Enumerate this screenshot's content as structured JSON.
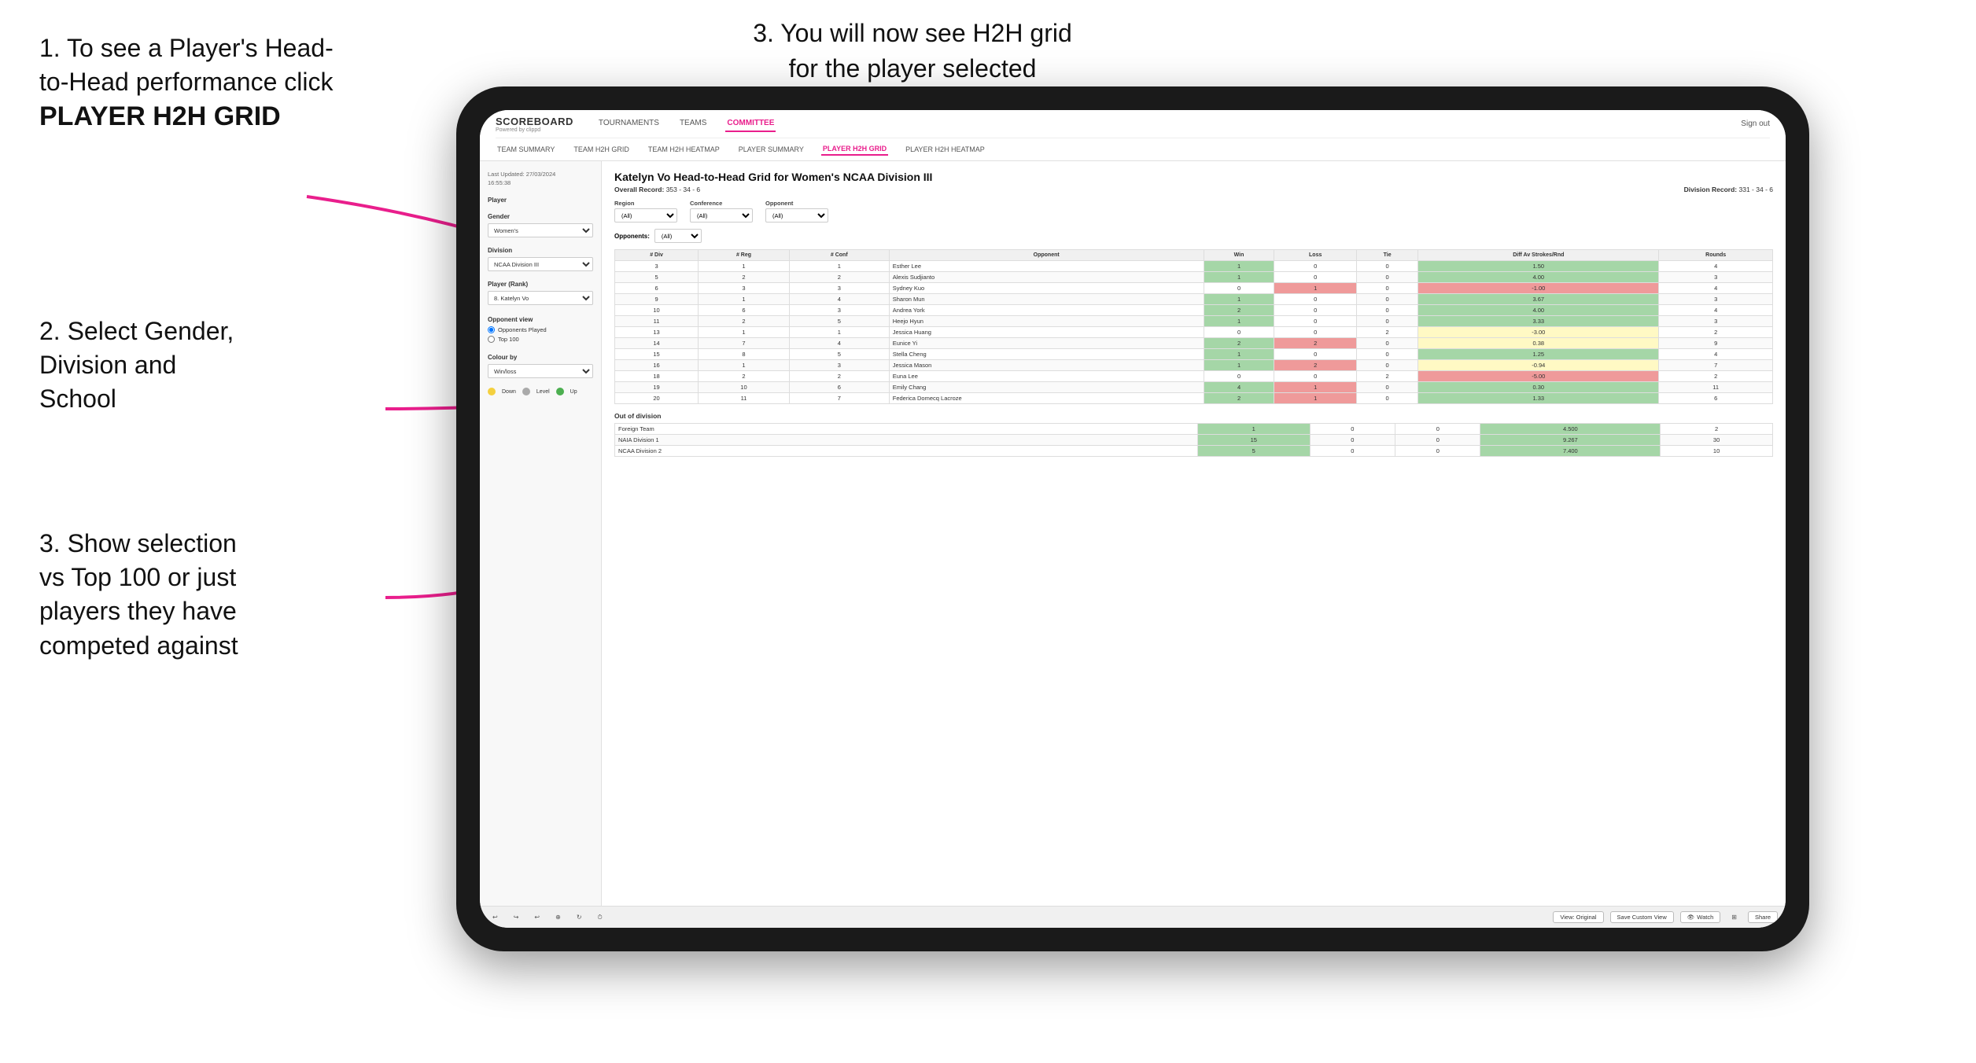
{
  "instructions": {
    "step1_line1": "1. To see a Player's Head-",
    "step1_line2": "to-Head performance click",
    "step1_bold": "PLAYER H2H GRID",
    "step2_line1": "2. Select Gender,",
    "step2_line2": "Division and",
    "step2_line3": "School",
    "step3_left_line1": "3. Show selection",
    "step3_left_line2": "vs Top 100 or just",
    "step3_left_line3": "players they have",
    "step3_left_line4": "competed against",
    "step3_top_line1": "3. You will now see H2H grid",
    "step3_top_line2": "for the player selected"
  },
  "app": {
    "logo": "SCOREBOARD",
    "logo_sub": "Powered by clippd",
    "nav_items": [
      "TOURNAMENTS",
      "TEAMS",
      "COMMITTEE"
    ],
    "nav_right": "Sign out",
    "sub_nav_items": [
      "TEAM SUMMARY",
      "TEAM H2H GRID",
      "TEAM H2H HEATMAP",
      "PLAYER SUMMARY",
      "PLAYER H2H GRID",
      "PLAYER H2H HEATMAP"
    ],
    "active_sub_nav": "PLAYER H2H GRID"
  },
  "sidebar": {
    "timestamp": "Last Updated: 27/03/2024\n16:55:38",
    "player_label": "Player",
    "gender_label": "Gender",
    "gender_value": "Women's",
    "division_label": "Division",
    "division_value": "NCAA Division III",
    "player_rank_label": "Player (Rank)",
    "player_rank_value": "8. Katelyn Vo",
    "opponent_view_label": "Opponent view",
    "radio_opponents": "Opponents Played",
    "radio_top100": "Top 100",
    "colour_by_label": "Colour by",
    "colour_by_value": "Win/loss",
    "legend_down": "Down",
    "legend_level": "Level",
    "legend_up": "Up"
  },
  "grid": {
    "title": "Katelyn Vo Head-to-Head Grid for Women's NCAA Division III",
    "overall_record_label": "Overall Record:",
    "overall_record_value": "353 - 34 - 6",
    "division_record_label": "Division Record:",
    "division_record_value": "331 - 34 - 6",
    "filter_region_label": "Region",
    "filter_conference_label": "Conference",
    "filter_opponent_label": "Opponent",
    "opponents_label": "Opponents:",
    "opponents_value": "(All)",
    "conference_value": "(All)",
    "opponent_filter_value": "(All)",
    "col_headers": [
      "# Div",
      "# Reg",
      "# Conf",
      "Opponent",
      "Win",
      "Loss",
      "Tie",
      "Diff Av Strokes/Rnd",
      "Rounds"
    ],
    "rows": [
      {
        "div": 3,
        "reg": 1,
        "conf": 1,
        "name": "Esther Lee",
        "win": 1,
        "loss": 0,
        "tie": 0,
        "diff": 1.5,
        "rounds": 4,
        "win_color": "green"
      },
      {
        "div": 5,
        "reg": 2,
        "conf": 2,
        "name": "Alexis Sudjianto",
        "win": 1,
        "loss": 0,
        "tie": 0,
        "diff": 4.0,
        "rounds": 3,
        "win_color": "green"
      },
      {
        "div": 6,
        "reg": 3,
        "conf": 3,
        "name": "Sydney Kuo",
        "win": 0,
        "loss": 1,
        "tie": 0,
        "diff": -1.0,
        "rounds": 4,
        "win_color": "red"
      },
      {
        "div": 9,
        "reg": 1,
        "conf": 4,
        "name": "Sharon Mun",
        "win": 1,
        "loss": 0,
        "tie": 0,
        "diff": 3.67,
        "rounds": 3,
        "win_color": "green"
      },
      {
        "div": 10,
        "reg": 6,
        "conf": 3,
        "name": "Andrea York",
        "win": 2,
        "loss": 0,
        "tie": 0,
        "diff": 4.0,
        "rounds": 4,
        "win_color": "green"
      },
      {
        "div": 11,
        "reg": 2,
        "conf": 5,
        "name": "Heejo Hyun",
        "win": 1,
        "loss": 0,
        "tie": 0,
        "diff": 3.33,
        "rounds": 3,
        "win_color": "green"
      },
      {
        "div": 13,
        "reg": 1,
        "conf": 1,
        "name": "Jessica Huang",
        "win": 0,
        "loss": 0,
        "tie": 2,
        "diff": -3.0,
        "rounds": 2,
        "win_color": "yellow"
      },
      {
        "div": 14,
        "reg": 7,
        "conf": 4,
        "name": "Eunice Yi",
        "win": 2,
        "loss": 2,
        "tie": 0,
        "diff": 0.38,
        "rounds": 9,
        "win_color": "yellow"
      },
      {
        "div": 15,
        "reg": 8,
        "conf": 5,
        "name": "Stella Cheng",
        "win": 1,
        "loss": 0,
        "tie": 0,
        "diff": 1.25,
        "rounds": 4,
        "win_color": "green"
      },
      {
        "div": 16,
        "reg": 1,
        "conf": 3,
        "name": "Jessica Mason",
        "win": 1,
        "loss": 2,
        "tie": 0,
        "diff": -0.94,
        "rounds": 7,
        "win_color": "yellow"
      },
      {
        "div": 18,
        "reg": 2,
        "conf": 2,
        "name": "Euna Lee",
        "win": 0,
        "loss": 0,
        "tie": 2,
        "diff": -5.0,
        "rounds": 2,
        "win_color": "red"
      },
      {
        "div": 19,
        "reg": 10,
        "conf": 6,
        "name": "Emily Chang",
        "win": 4,
        "loss": 1,
        "tie": 0,
        "diff": 0.3,
        "rounds": 11,
        "win_color": "green"
      },
      {
        "div": 20,
        "reg": 11,
        "conf": 7,
        "name": "Federica Domecq Lacroze",
        "win": 2,
        "loss": 1,
        "tie": 0,
        "diff": 1.33,
        "rounds": 6,
        "win_color": "green"
      }
    ],
    "out_of_division_title": "Out of division",
    "out_of_division_rows": [
      {
        "name": "Foreign Team",
        "win": 1,
        "loss": 0,
        "tie": 0,
        "diff": 4.5,
        "rounds": 2
      },
      {
        "name": "NAIA Division 1",
        "win": 15,
        "loss": 0,
        "tie": 0,
        "diff": 9.267,
        "rounds": 30
      },
      {
        "name": "NCAA Division 2",
        "win": 5,
        "loss": 0,
        "tie": 0,
        "diff": 7.4,
        "rounds": 10
      }
    ]
  },
  "toolbar": {
    "view_original": "View: Original",
    "save_custom_view": "Save Custom View",
    "watch": "Watch",
    "share": "Share"
  }
}
